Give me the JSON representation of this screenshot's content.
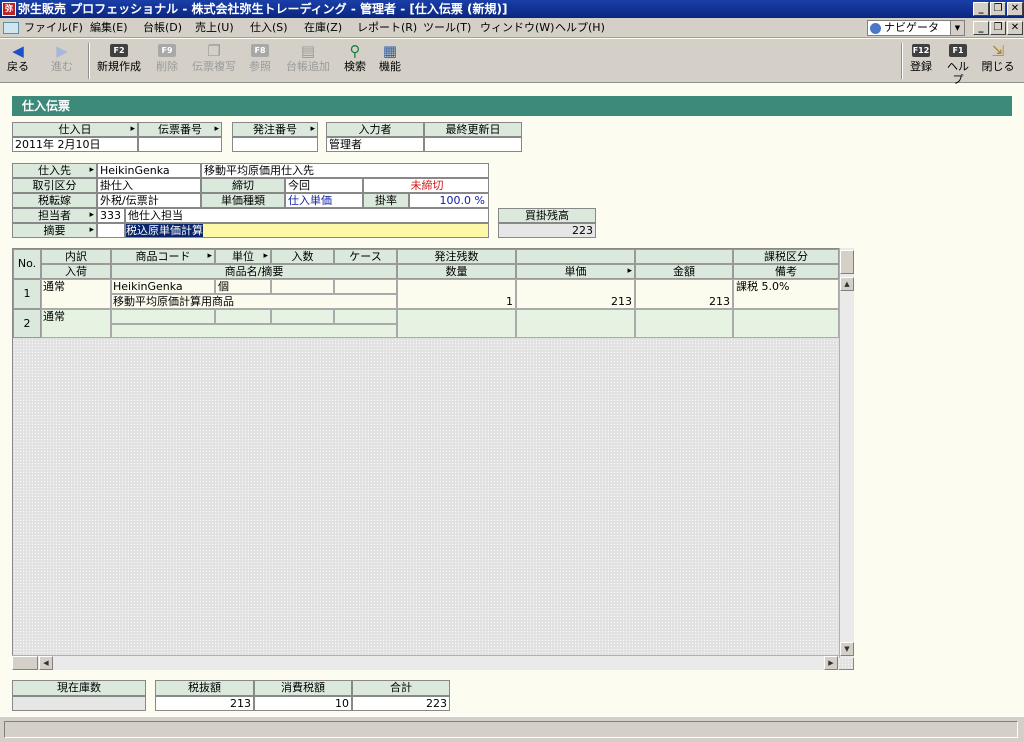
{
  "window": {
    "title": "弥生販売 プロフェッショナル - 株式会社弥生トレーディング - 管理者 - [仕入伝票 (新規)]",
    "app_icon_text": "弥"
  },
  "menu": {
    "items": [
      "ファイル(F)",
      "編集(E)",
      "台帳(D)",
      "売上(U)",
      "仕入(S)",
      "在庫(Z)",
      "レポート(R)",
      "ツール(T)",
      "ウィンドウ(W)",
      "ヘルプ(H)"
    ],
    "navigator": "ナビゲータ"
  },
  "toolbar": {
    "back": "戻る",
    "forward": "進む",
    "new": {
      "key": "F2",
      "label": "新規作成"
    },
    "delete": {
      "key": "F9",
      "label": "削除"
    },
    "copy": {
      "key": "",
      "label": "伝票複写"
    },
    "ref": {
      "key": "F8",
      "label": "参照"
    },
    "ledger": {
      "key": "",
      "label": "台帳追加"
    },
    "search": {
      "key": "",
      "label": "検索"
    },
    "func": {
      "key": "",
      "label": "機能"
    },
    "register": {
      "key": "F12",
      "label": "登録"
    },
    "help": {
      "key": "F1",
      "label": "ヘルプ"
    },
    "close": {
      "key": "",
      "label": "閉じる"
    }
  },
  "form": {
    "title": "仕入伝票",
    "header": {
      "date_label": "仕入日",
      "date_value": "2011年 2月10日",
      "slip_no_label": "伝票番号",
      "slip_no_value": "",
      "order_no_label": "発注番号",
      "order_no_value": "",
      "inputter_label": "入力者",
      "inputter_value": "管理者",
      "updated_label": "最終更新日",
      "updated_value": ""
    },
    "supplier_label": "仕入先",
    "supplier_code": "HeikinGenka",
    "supplier_name": "移動平均原価用仕入先",
    "trade_label": "取引区分",
    "trade_value": "掛仕入",
    "cutoff_label": "締切",
    "cutoff_value": "今回",
    "cutoff_status": "未締切",
    "tax_label": "税転嫁",
    "tax_value": "外税/伝票計",
    "price_type_label": "単価種類",
    "price_type_value": "仕入単価",
    "rate_label": "掛率",
    "rate_value": "100.0 %",
    "staff_label": "担当者",
    "staff_code": "333",
    "staff_name": "他仕入担当",
    "memo_label": "摘要",
    "memo_value": "税込原単価計算",
    "payable_label": "買掛残高",
    "payable_value": "223"
  },
  "grid": {
    "row_no_label": "No.",
    "headers_top": [
      "内訳",
      "商品コード",
      "単位",
      "入数",
      "ケース",
      "発注残数",
      "",
      "",
      "課税区分"
    ],
    "headers_bottom": [
      "入荷",
      "商品名/摘要",
      "数量",
      "単価",
      "金額",
      "備考"
    ],
    "rows": [
      {
        "no": "1",
        "kind": "通常",
        "code": "HeikinGenka",
        "unit": "個",
        "name": "移動平均原価計算用商品",
        "qty": "1",
        "price": "213",
        "amount": "213",
        "tax": "課税 5.0%"
      },
      {
        "no": "2",
        "kind": "通常",
        "code": "",
        "unit": "",
        "name": "",
        "qty": "",
        "price": "",
        "amount": "",
        "tax": ""
      }
    ]
  },
  "footer": {
    "stock_label": "現在庫数",
    "stock_value": "",
    "subtotal_label": "税抜額",
    "subtotal_value": "213",
    "tax_label": "消費税額",
    "tax_value": "10",
    "total_label": "合計",
    "total_value": "223"
  }
}
